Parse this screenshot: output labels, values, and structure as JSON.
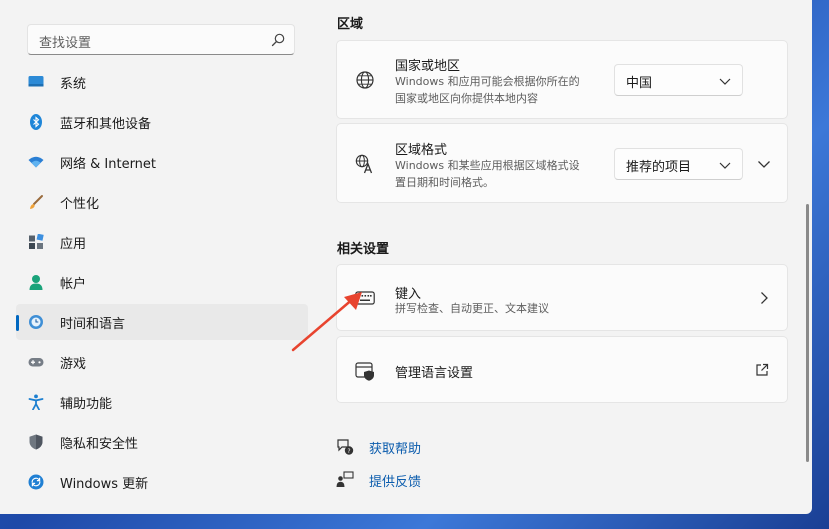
{
  "search": {
    "placeholder": "查找设置",
    "icon": "search-icon"
  },
  "sidebar": {
    "active_index": 6,
    "items": [
      {
        "label": "系统",
        "icon": "display-icon"
      },
      {
        "label": "蓝牙和其他设备",
        "icon": "bluetooth-icon"
      },
      {
        "label": "网络 & Internet",
        "icon": "wifi-icon"
      },
      {
        "label": "个性化",
        "icon": "brush-icon"
      },
      {
        "label": "应用",
        "icon": "apps-icon"
      },
      {
        "label": "帐户",
        "icon": "account-icon"
      },
      {
        "label": "时间和语言",
        "icon": "clock-globe-icon"
      },
      {
        "label": "游戏",
        "icon": "gamepad-icon"
      },
      {
        "label": "辅助功能",
        "icon": "accessibility-icon"
      },
      {
        "label": "隐私和安全性",
        "icon": "shield-icon"
      },
      {
        "label": "Windows 更新",
        "icon": "update-icon"
      }
    ]
  },
  "region": {
    "section_title": "区域",
    "country": {
      "title": "国家或地区",
      "description_line1": "Windows 和应用可能会根据你所在的",
      "description_line2": "国家或地区向你提供本地内容",
      "value": "中国",
      "icon": "globe-icon"
    },
    "format": {
      "title": "区域格式",
      "description_line1": "Windows 和某些应用根据区域格式设",
      "description_line2": "置日期和时间格式。",
      "value": "推荐的项目",
      "icon": "language-format-icon"
    }
  },
  "related": {
    "section_title": "相关设置",
    "typing": {
      "title": "键入",
      "description": "拼写检查、自动更正、文本建议",
      "icon": "keyboard-icon"
    },
    "admin": {
      "title": "管理语言设置",
      "icon": "admin-shield-icon",
      "action_icon": "external-link-icon"
    }
  },
  "links": {
    "help": "获取帮助",
    "feedback": "提供反馈"
  },
  "colors": {
    "accent": "#0067c0",
    "link": "#0b5cad",
    "annotation_arrow": "#e8442f"
  }
}
